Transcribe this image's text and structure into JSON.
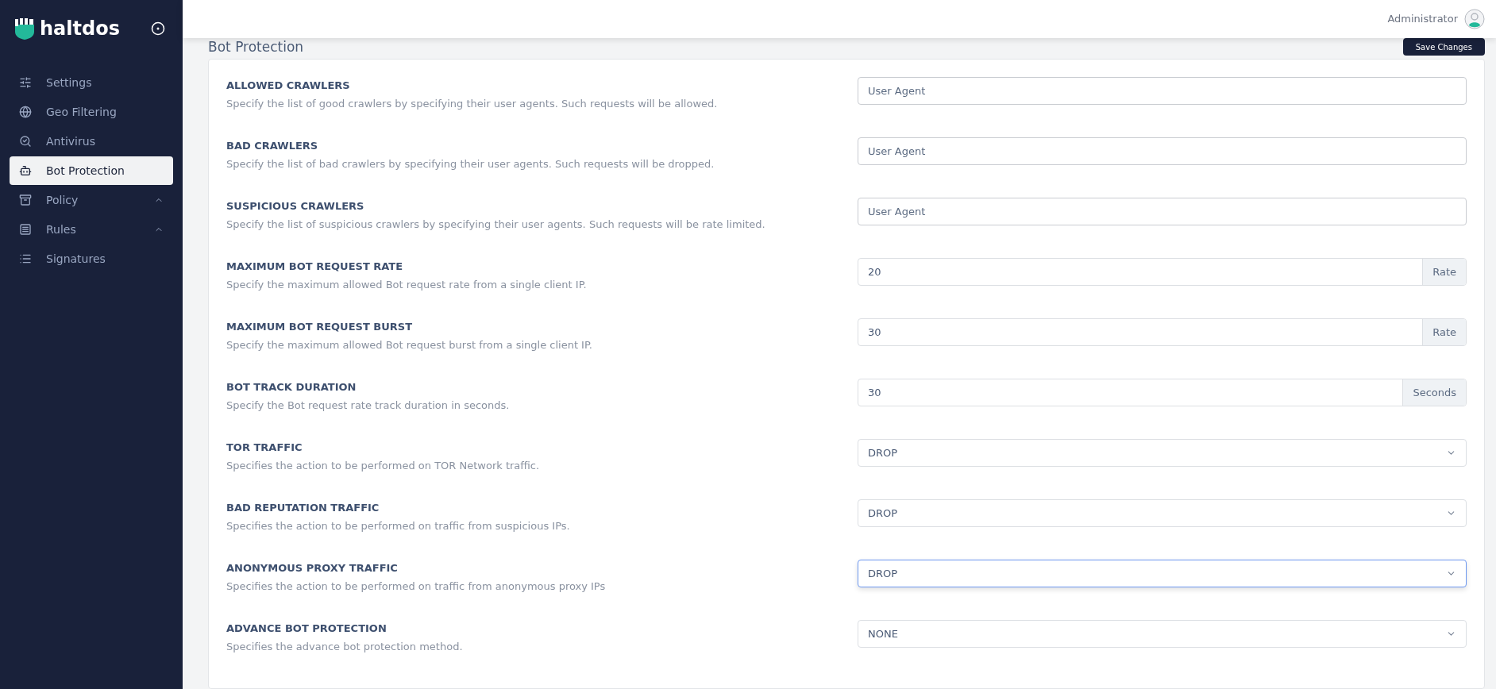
{
  "brand": {
    "name": "haltdos"
  },
  "sidebar": {
    "items": [
      {
        "label": "Settings",
        "selected": false,
        "expandable": false
      },
      {
        "label": "Geo Filtering",
        "selected": false,
        "expandable": false
      },
      {
        "label": "Antivirus",
        "selected": false,
        "expandable": false
      },
      {
        "label": "Bot Protection",
        "selected": true,
        "expandable": false
      },
      {
        "label": "Policy",
        "selected": false,
        "expandable": true
      },
      {
        "label": "Rules",
        "selected": false,
        "expandable": true
      },
      {
        "label": "Signatures",
        "selected": false,
        "expandable": false
      }
    ]
  },
  "topbar": {
    "user": "Administrator"
  },
  "page": {
    "title": "Bot Protection",
    "save_button": "Save Changes"
  },
  "fields": [
    {
      "kind": "text",
      "label": "ALLOWED CRAWLERS",
      "description": "Specify the list of good crawlers by specifying their user agents. Such requests will be allowed.",
      "placeholder": "User Agent"
    },
    {
      "kind": "text",
      "label": "BAD CRAWLERS",
      "description": "Specify the list of bad crawlers by specifying their user agents. Such requests will be dropped.",
      "placeholder": "User Agent"
    },
    {
      "kind": "text",
      "label": "SUSPICIOUS CRAWLERS",
      "description": "Specify the list of suspicious crawlers by specifying their user agents. Such requests will be rate limited.",
      "placeholder": "User Agent"
    },
    {
      "kind": "addon",
      "label": "MAXIMUM BOT REQUEST RATE",
      "description": "Specify the maximum allowed Bot request rate from a single client IP.",
      "value": "20",
      "addon": "Rate"
    },
    {
      "kind": "addon",
      "label": "MAXIMUM BOT REQUEST BURST",
      "description": "Specify the maximum allowed Bot request burst from a single client IP.",
      "value": "30",
      "addon": "Rate"
    },
    {
      "kind": "addon",
      "label": "BOT TRACK DURATION",
      "description": "Specify the Bot request rate track duration in seconds.",
      "value": "30",
      "addon": "Seconds"
    },
    {
      "kind": "select",
      "label": "TOR TRAFFIC",
      "description": "Specifies the action to be performed on TOR Network traffic.",
      "value": "DROP",
      "focused": false
    },
    {
      "kind": "select",
      "label": "BAD REPUTATION TRAFFIC",
      "description": "Specifies the action to be performed on traffic from suspicious IPs.",
      "value": "DROP",
      "focused": false
    },
    {
      "kind": "select",
      "label": "ANONYMOUS PROXY TRAFFIC",
      "description": "Specifies the action to be performed on traffic from anonymous proxy IPs",
      "value": "DROP",
      "focused": true
    },
    {
      "kind": "select",
      "label": "ADVANCE BOT PROTECTION",
      "description": "Specifies the advance bot protection method.",
      "value": "NONE",
      "focused": false
    }
  ]
}
